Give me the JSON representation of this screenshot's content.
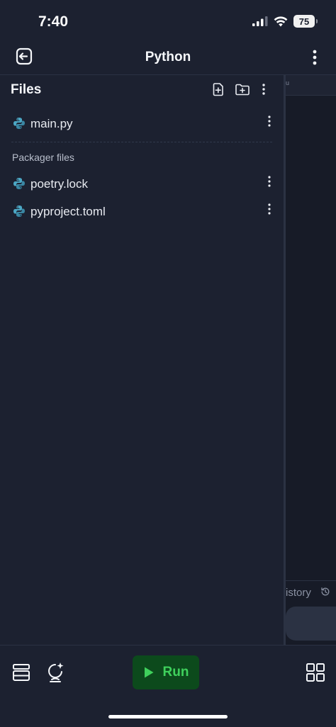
{
  "status_bar": {
    "time": "7:40",
    "battery": "75",
    "icons": [
      "signal-icon",
      "wifi-icon",
      "battery-icon"
    ]
  },
  "top_bar": {
    "title": "Python",
    "left_icon": "exit-icon",
    "right_icon": "more-vertical-icon"
  },
  "files_panel": {
    "title": "Files",
    "actions": [
      "new-file-icon",
      "new-folder-icon",
      "more-vertical-icon"
    ],
    "files": [
      {
        "name": "main.py",
        "icon": "python-icon"
      }
    ],
    "packager_section": {
      "label": "Packager files",
      "files": [
        {
          "name": "poetry.lock",
          "icon": "python-icon"
        },
        {
          "name": "pyproject.toml",
          "icon": "python-icon"
        }
      ]
    }
  },
  "right_pane": {
    "tab_hint": "u",
    "history_label": "istory",
    "history_icon": "history-icon"
  },
  "bottom_bar": {
    "run_label": "Run",
    "left_icons": [
      "layers-icon",
      "ai-assistant-icon"
    ],
    "right_icon": "grid-icon"
  },
  "colors": {
    "background": "#1c2130",
    "run_button_bg": "#0c4a1c",
    "run_button_fg": "#3fd15c",
    "python_icon": "#4ca7c4"
  }
}
